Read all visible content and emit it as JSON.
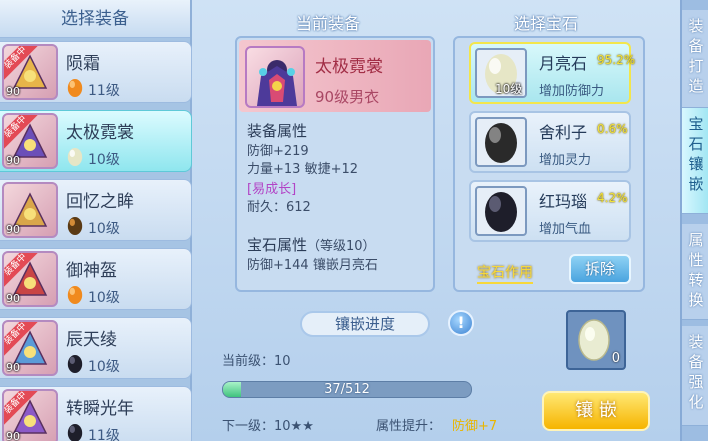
{
  "left_panel": {
    "title": "选择装备",
    "items": [
      {
        "name": "陨霜",
        "level": "90",
        "gem_level": "11级",
        "gem_color": "orange",
        "equipped": true,
        "equipped_label": "装备中",
        "selected": false
      },
      {
        "name": "太极霓裳",
        "level": "90",
        "gem_level": "10级",
        "gem_color": "pearl",
        "equipped": true,
        "equipped_label": "装备中",
        "selected": true
      },
      {
        "name": "回忆之眸",
        "level": "90",
        "gem_level": "10级",
        "gem_color": "dark-amber",
        "equipped": false,
        "selected": false
      },
      {
        "name": "御神盔",
        "level": "90",
        "gem_level": "10级",
        "gem_color": "orange",
        "equipped": true,
        "equipped_label": "装备中",
        "selected": false
      },
      {
        "name": "辰天绫",
        "level": "90",
        "gem_level": "10级",
        "gem_color": "black",
        "equipped": true,
        "equipped_label": "装备中",
        "selected": false
      },
      {
        "name": "转瞬光年",
        "level": "90",
        "gem_level": "11级",
        "gem_color": "black",
        "equipped": true,
        "equipped_label": "装备中",
        "selected": false
      }
    ]
  },
  "current_equipment": {
    "title": "当前装备",
    "name": "太极霓裳",
    "subtitle": "90级男衣",
    "attr_title": "装备属性",
    "attr_lines": [
      "防御+219",
      "力量+13 敏捷+12"
    ],
    "special": "[易成长]",
    "durability": "耐久：612",
    "gem_attr_title": "宝石属性",
    "gem_attr_level": "（等级10）",
    "gem_attr_line": "防御+144 镶嵌月亮石"
  },
  "gem_select": {
    "title": "选择宝石",
    "gems": [
      {
        "name": "月亮石",
        "rate": "95.2%",
        "effect": "增加防御力",
        "level": "10级",
        "color": "pearl",
        "selected": true
      },
      {
        "name": "舍利子",
        "rate": "0.6%",
        "effect": "增加灵力",
        "level": "",
        "color": "dark-stones",
        "selected": false
      },
      {
        "name": "红玛瑙",
        "rate": "4.2%",
        "effect": "增加气血",
        "level": "",
        "color": "black",
        "selected": false
      }
    ],
    "effect_link": "宝石作用",
    "remove_label": "拆除"
  },
  "inlay": {
    "progress_title": "镶嵌进度",
    "info_icon": "!",
    "current_level_label": "当前级：10",
    "progress_text": "37/512",
    "progress_value": 37,
    "progress_max": 512,
    "next_level_label": "下一级：10★★",
    "attr_gain_label": "属性提升：",
    "attr_gain_value": "防御+7",
    "cost_count": "0",
    "inlay_button": "镶 嵌"
  },
  "right_tabs": [
    {
      "label": "装备打造",
      "active": false
    },
    {
      "label": "宝石镶嵌",
      "active": true
    },
    {
      "label": "属性转换",
      "active": false
    },
    {
      "label": "装备强化",
      "active": false
    }
  ]
}
